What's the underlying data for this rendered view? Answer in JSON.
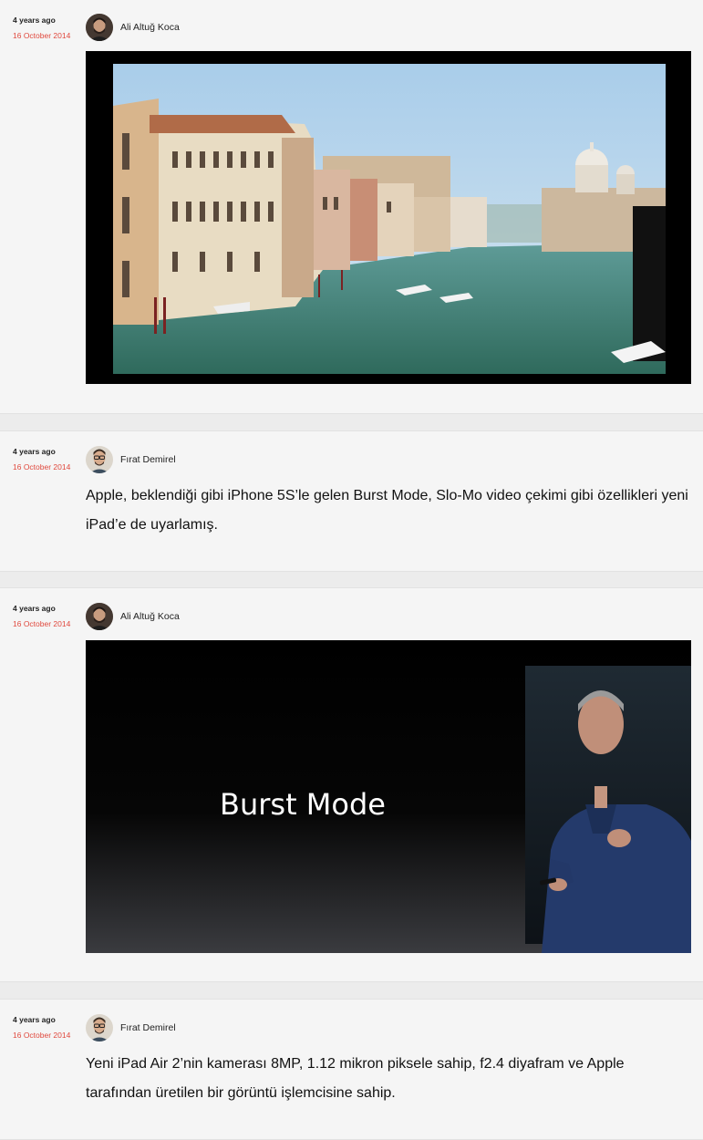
{
  "posts": [
    {
      "relative_time": "4 years ago",
      "date": "16 October 2014",
      "author": "Ali Altuğ Koca",
      "avatar_icon": "author-avatar",
      "media": "image-venice-grand-canal"
    },
    {
      "relative_time": "4 years ago",
      "date": "16 October 2014",
      "author": "Fırat Demirel",
      "avatar_icon": "author-avatar",
      "text": "Apple, beklendiği gibi iPhone 5S’le gelen Burst Mode, Slo-Mo video çekimi gibi özellikleri yeni iPad’e de uyarlamış."
    },
    {
      "relative_time": "4 years ago",
      "date": "16 October 2014",
      "author": "Ali Altuğ Koca",
      "avatar_icon": "author-avatar",
      "media": "image-burst-mode-keynote",
      "media_caption": "Burst Mode"
    },
    {
      "relative_time": "4 years ago",
      "date": "16 October 2014",
      "author": "Fırat Demirel",
      "avatar_icon": "author-avatar",
      "text": "Yeni iPad Air 2’nin kamerası 8MP, 1.12 mikron piksele sahip, f2.4 diyafram ve Apple tarafından üretilen bir görüntü işlemcisine sahip."
    }
  ],
  "colors": {
    "date": "#e0483d",
    "card": "#f5f5f5",
    "page": "#ececec"
  }
}
